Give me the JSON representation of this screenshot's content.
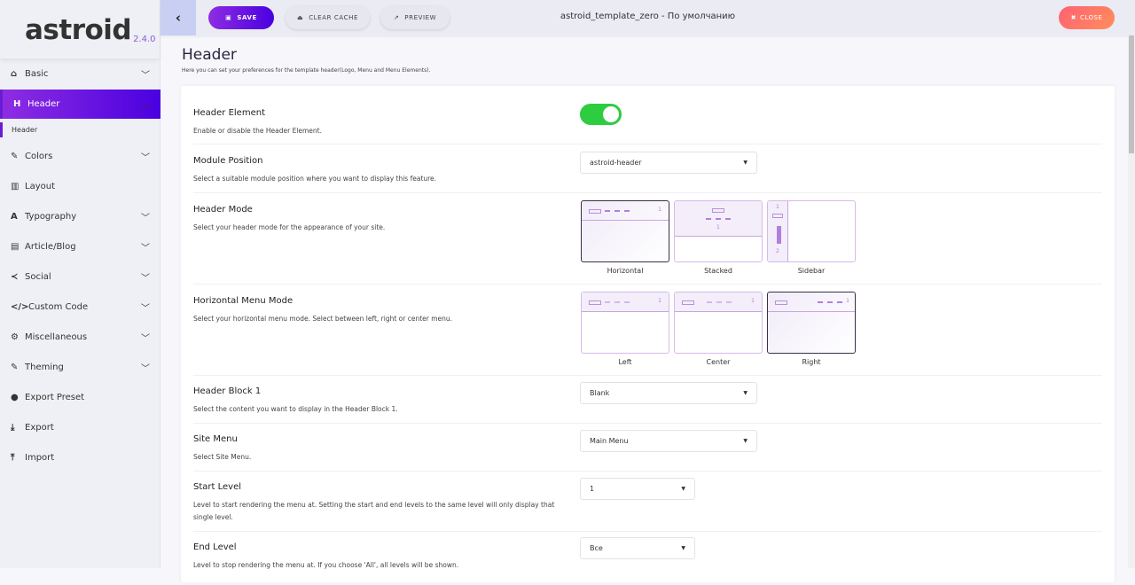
{
  "logo": {
    "name": "astroid",
    "version": "2.4.0"
  },
  "sidebar": {
    "items": [
      {
        "label": "Basic",
        "icon": "home-icon",
        "expandable": true
      },
      {
        "label": "Header",
        "icon": "heading-icon",
        "expandable": true,
        "active": true
      },
      {
        "label": "Header",
        "sub": true
      },
      {
        "label": "Colors",
        "icon": "brush-icon",
        "expandable": true
      },
      {
        "label": "Layout",
        "icon": "columns-icon"
      },
      {
        "label": "Typography",
        "icon": "font-icon",
        "expandable": true
      },
      {
        "label": "Article/Blog",
        "icon": "newspaper-icon",
        "expandable": true
      },
      {
        "label": "Social",
        "icon": "share-icon",
        "expandable": true
      },
      {
        "label": "Custom Code",
        "icon": "code-icon",
        "expandable": true
      },
      {
        "label": "Miscellaneous",
        "icon": "cogs-icon",
        "expandable": true
      },
      {
        "label": "Theming",
        "icon": "brush-icon",
        "expandable": true
      },
      {
        "label": "Export Preset",
        "icon": "palette-icon"
      },
      {
        "label": "Export",
        "icon": "download-icon"
      },
      {
        "label": "Import",
        "icon": "upload-icon"
      }
    ]
  },
  "toolbar": {
    "save": "SAVE",
    "clear_cache": "CLEAR CACHE",
    "preview": "PREVIEW",
    "title": "astroid_template_zero - По умолчанию",
    "close": "CLOSE"
  },
  "page": {
    "title": "Header",
    "subtitle": "Here you can set your preferences for the template header(Logo, Menu and Menu Elements)."
  },
  "fields": {
    "header_element": {
      "label": "Header Element",
      "desc": "Enable or disable the Header Element.",
      "value": true
    },
    "module_position": {
      "label": "Module Position",
      "desc": "Select a suitable module position where you want to display this feature.",
      "value": "astroid-header"
    },
    "header_mode": {
      "label": "Header Mode",
      "desc": "Select your header mode for the appearance of your site.",
      "options": [
        "Horizontal",
        "Stacked",
        "Sidebar"
      ],
      "selected": "Horizontal"
    },
    "horizontal_menu_mode": {
      "label": "Horizontal Menu Mode",
      "desc": "Select your horizontal menu mode. Select between left, right or center menu.",
      "options": [
        "Left",
        "Center",
        "Right"
      ],
      "selected": "Right"
    },
    "header_block_1": {
      "label": "Header Block 1",
      "desc": "Select the content you want to display in the Header Block 1.",
      "value": "Blank"
    },
    "site_menu": {
      "label": "Site Menu",
      "desc": "Select Site Menu.",
      "value": "Main Menu"
    },
    "start_level": {
      "label": "Start Level",
      "desc": "Level to start rendering the menu at. Setting the start and end levels to the same level will only display that single level.",
      "value": "1"
    },
    "end_level": {
      "label": "End Level",
      "desc": "Level to stop rendering the menu at. If you choose 'All', all levels will be shown.",
      "value": "Все"
    }
  },
  "thumb_marks": {
    "one": "1",
    "two": "2"
  }
}
